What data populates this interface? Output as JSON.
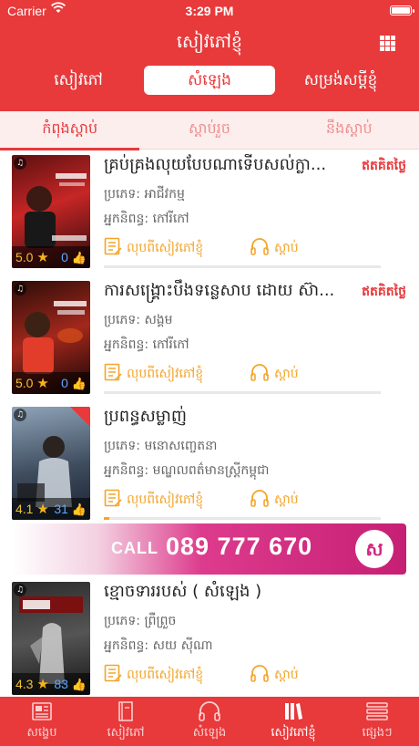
{
  "status": {
    "carrier": "Carrier",
    "time": "3:29 PM"
  },
  "header": {
    "title": "សៀវភៅខ្ញុំ"
  },
  "segment": {
    "items": [
      "សៀវភៅ",
      "សំឡេង",
      "សម្រង់សម្ដីខ្ញុំ"
    ],
    "active_index": 1
  },
  "subtabs": {
    "items": [
      "កំពុងស្ដាប់",
      "ស្ដាប់រួច",
      "នឹងស្ដាប់"
    ],
    "active_index": 0
  },
  "items": [
    {
      "title": "គ្រប់គ្រងលុយបែបណាទើបសល់ក្លា...",
      "badge": "ឥតគិតថ្លៃ",
      "category": "ប្រភេទ: អាជីវកម្ម",
      "author": "អ្នកនិពន្ធ: កៅរីកៅ",
      "rating": "5.0",
      "likes": "0",
      "read_label": "លុបពីសៀវភៅខ្ញុំ",
      "listen_label": "ស្ដាប់",
      "progress": 0.0
    },
    {
      "title": "ការសង្គ្រោះបឹងទន្លេសាប ដោយ ស៊ា...",
      "badge": "ឥតគិតថ្លៃ",
      "category": "ប្រភេទ: សង្គម",
      "author": "អ្នកនិពន្ធ: កៅរីកៅ",
      "rating": "5.0",
      "likes": "0",
      "read_label": "លុបពីសៀវភៅខ្ញុំ",
      "listen_label": "ស្ដាប់",
      "progress": 0.0
    },
    {
      "title": "ប្រពន្ធសម្លាញ់",
      "badge": "",
      "category": "ប្រភេទ: មនោសញ្ចេតនា",
      "author": "អ្នកនិពន្ធ: មណ្ឌលពត៌មានស្រ្តីកម្ពុជា",
      "rating": "4.1",
      "likes": "31",
      "read_label": "លុបពីសៀវភៅខ្ញុំ",
      "listen_label": "ស្ដាប់",
      "progress": 0.02
    },
    {
      "title": "ខ្មោចទាររបស់ ( សំឡេង )",
      "badge": "",
      "category": "ប្រភេទ: ព្រឺព្រួច",
      "author": "អ្នកនិពន្ធ: សយ ស៊ីណា",
      "rating": "4.3",
      "likes": "83",
      "read_label": "លុបពីសៀវភៅខ្ញុំ",
      "listen_label": "ស្ដាប់",
      "progress": 0.0
    }
  ],
  "ad": {
    "call": "CALL",
    "number": "089 777 670",
    "logo": "ស"
  },
  "tabbar": {
    "items": [
      "សង្ខេប",
      "សៀវភៅ",
      "សំឡេង",
      "សៀវភៅខ្ញុំ",
      "ផ្សេងៗ"
    ],
    "active_index": 3
  },
  "colors": {
    "accent": "#e8393b",
    "highlight": "#f3a52b",
    "free": "#e8393b"
  }
}
